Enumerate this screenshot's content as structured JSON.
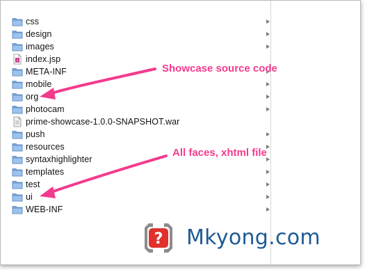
{
  "files": [
    {
      "name": "css",
      "type": "folder"
    },
    {
      "name": "design",
      "type": "folder"
    },
    {
      "name": "images",
      "type": "folder"
    },
    {
      "name": "index.jsp",
      "type": "jsp-file"
    },
    {
      "name": "META-INF",
      "type": "folder"
    },
    {
      "name": "mobile",
      "type": "folder"
    },
    {
      "name": "org",
      "type": "folder"
    },
    {
      "name": "photocam",
      "type": "folder"
    },
    {
      "name": "prime-showcase-1.0.0-SNAPSHOT.war",
      "type": "war-file"
    },
    {
      "name": "push",
      "type": "folder"
    },
    {
      "name": "resources",
      "type": "folder"
    },
    {
      "name": "syntaxhighlighter",
      "type": "folder"
    },
    {
      "name": "templates",
      "type": "folder"
    },
    {
      "name": "test",
      "type": "folder"
    },
    {
      "name": "ui",
      "type": "folder"
    },
    {
      "name": "WEB-INF",
      "type": "folder"
    }
  ],
  "annotations": {
    "source_code": "Showcase source code",
    "faces": "All faces, xhtml file"
  },
  "brand": {
    "name": "Mkyong.com",
    "logo_icon": "question-mark-icon"
  },
  "colors": {
    "annotation": "#f43a8d",
    "brand_text": "#1f5a93",
    "folder": "#8fb7e6",
    "logo": "#e0312d"
  }
}
